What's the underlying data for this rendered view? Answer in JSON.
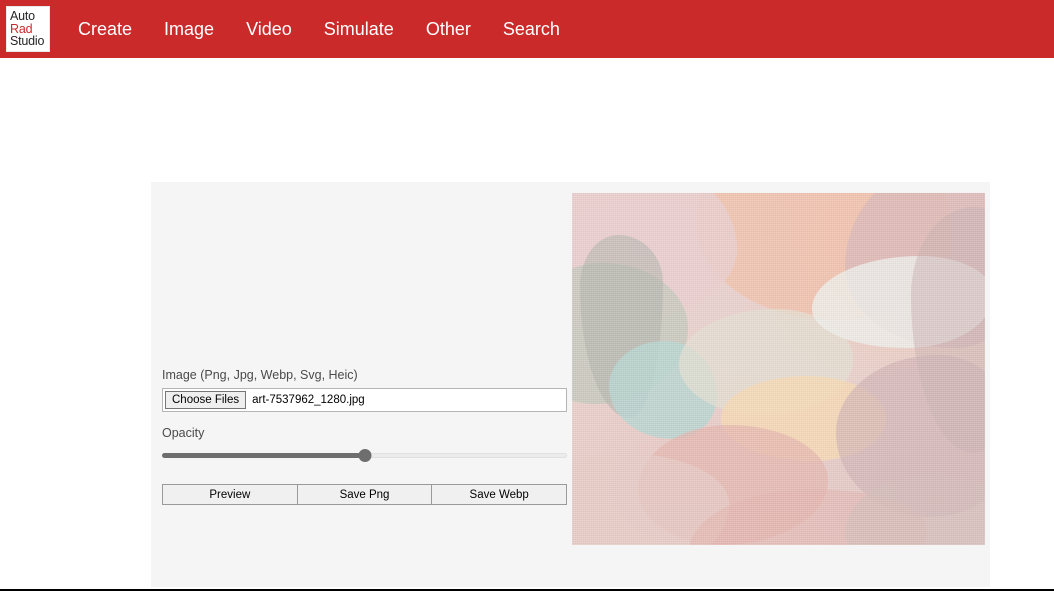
{
  "navbar": {
    "brand": {
      "line1": "Auto",
      "line2": "Rad",
      "line3": "Studio"
    },
    "background_color": "#cb2a2a",
    "links": [
      {
        "label": "Create"
      },
      {
        "label": "Image"
      },
      {
        "label": "Video"
      },
      {
        "label": "Simulate"
      },
      {
        "label": "Other"
      },
      {
        "label": "Search"
      }
    ]
  },
  "main": {
    "card_background_color": "#f5f5f5",
    "form": {
      "image_field": {
        "label": "Image (Png, Jpg, Webp, Svg, Heic)",
        "choose_button_label": "Choose Files",
        "selected_file": "art-7537962_1280.jpg"
      },
      "opacity": {
        "label": "Opacity",
        "value": 50,
        "min": 0,
        "max": 100
      },
      "buttons": [
        {
          "label": "Preview"
        },
        {
          "label": "Save Png"
        },
        {
          "label": "Save Webp"
        }
      ]
    },
    "preview": {
      "alt": "abstract pastel blob artwork",
      "palette": [
        "#e9c8c3",
        "#efb69f",
        "#d8c9bd",
        "#c2d0c6",
        "#b9d3cf",
        "#ece4d8",
        "#f5d3ae",
        "#d7b7bb",
        "#cfa9a4",
        "#e7e7e2"
      ]
    }
  }
}
